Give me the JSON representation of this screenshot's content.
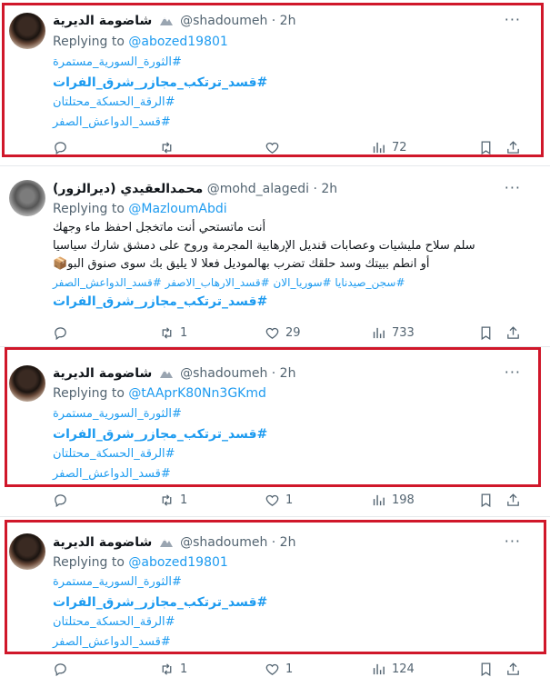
{
  "tweets": [
    {
      "name": "شاضومة الديرية",
      "handle": "@shadoumeh",
      "time": "· 2h",
      "reply_prefix": "Replying to",
      "reply_to": "@abozed19801",
      "lines": [
        "#الثورة_السورية_مستمرة",
        "#قسد_ترتكب_مجازر_شرق_الفرات",
        "#الرقة_الحسكة_محتلتان",
        "#قسد_الدواعش_الصفر"
      ],
      "replies": "",
      "retweets": "",
      "likes": "",
      "views": "72"
    },
    {
      "name": "محمدالعقيدي (ديرالزور)",
      "handle": "@mohd_alagedi",
      "time": "· 2h",
      "reply_prefix": "Replying to",
      "reply_to": "@MazloumAbdi",
      "lines": [
        "أنت ماتستحي أنت ماتخجل احفظ ماء وجهك",
        "سلم سلاح مليشيات وعصابات قنديل الإرهابية المجرمة وروح على دمشق شارك سياسيا",
        "أو انطم ببيتك وسد حلقك تضرب بهالموديل فعلا لا يليق بك سوى صنوق البو📦",
        "#سجن_صيدنايا #سوريا_الان #قسد_الارهاب_الاصفر #قسد_الدواعش_الصفر",
        "#قسد_ترتكب_مجازر_شرق_الفرات"
      ],
      "replies": "",
      "retweets": "1",
      "likes": "29",
      "views": "733"
    },
    {
      "name": "شاضومة الديرية",
      "handle": "@shadoumeh",
      "time": "· 2h",
      "reply_prefix": "Replying to",
      "reply_to": "@tAAprK80Nn3GKmd",
      "lines": [
        "#الثورة_السورية_مستمرة",
        "#قسد_ترتكب_مجازر_شرق_الفرات",
        "#الرقة_الحسكة_محتلتان",
        "#قسد_الدواعش_الصفر"
      ],
      "replies": "",
      "retweets": "1",
      "likes": "1",
      "views": "198"
    },
    {
      "name": "شاضومة الديرية",
      "handle": "@shadoumeh",
      "time": "· 2h",
      "reply_prefix": "Replying to",
      "reply_to": "@abozed19801",
      "lines": [
        "#الثورة_السورية_مستمرة",
        "#قسد_ترتكب_مجازر_شرق_الفرات",
        "#الرقة_الحسكة_محتلتان",
        "#قسد_الدواعش_الصفر"
      ],
      "replies": "",
      "retweets": "1",
      "likes": "1",
      "views": "124"
    }
  ],
  "more_label": "···",
  "colors": {
    "highlight": "#d0172a",
    "link": "#1d9bf0",
    "muted": "#536471"
  }
}
